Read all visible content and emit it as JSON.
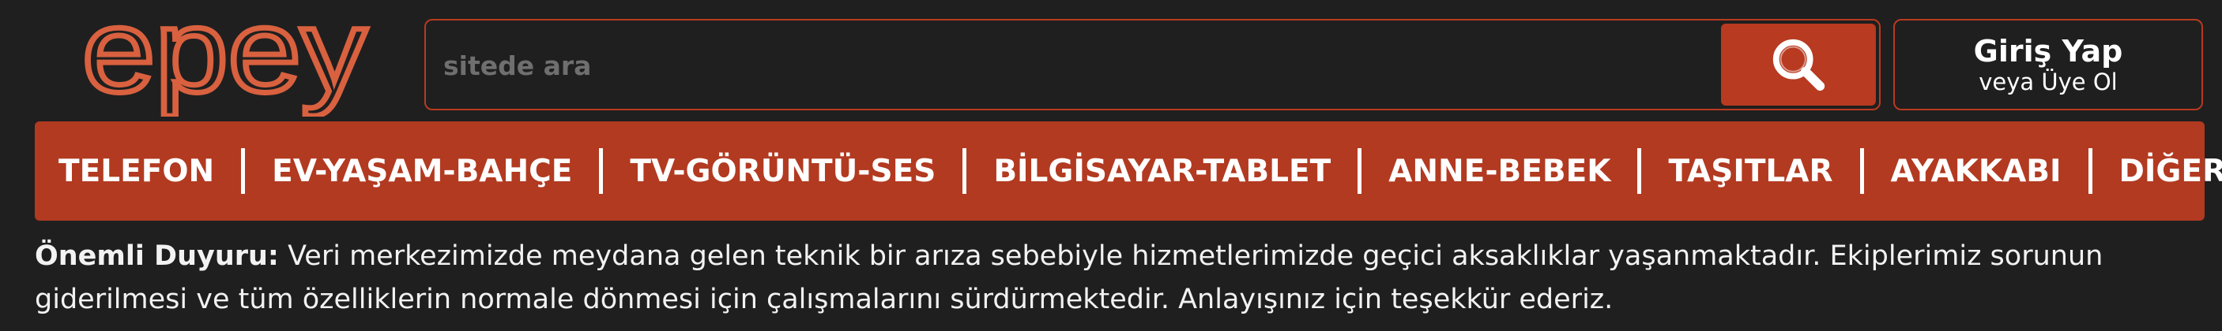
{
  "brand": {
    "logo_text": "epey",
    "logo_color": "#d9613f"
  },
  "colors": {
    "accent": "#b23a21",
    "background": "#1f1f1f",
    "text": "#ffffff"
  },
  "search": {
    "placeholder": "sitede ara",
    "value": "",
    "button_icon": "search-icon"
  },
  "account": {
    "login_label": "Giriş Yap",
    "register_label": "veya Üye Ol"
  },
  "nav": {
    "items": [
      {
        "label": "TELEFON"
      },
      {
        "label": "EV-YAŞAM-BAHÇE"
      },
      {
        "label": "TV-GÖRÜNTÜ-SES"
      },
      {
        "label": "BİLGİSAYAR-TABLET"
      },
      {
        "label": "ANNE-BEBEK"
      },
      {
        "label": "TAŞITLAR"
      },
      {
        "label": "AYAKKABI"
      },
      {
        "label": "DİĞER"
      }
    ]
  },
  "notice": {
    "title": "Önemli Duyuru:",
    "text": "Veri merkezimizde meydana gelen teknik bir arıza sebebiyle hizmetlerimizde geçici aksaklıklar yaşanmaktadır. Ekiplerimiz sorunun giderilmesi ve tüm özelliklerin normale dönmesi için çalışmalarını sürdürmektedir. Anlayışınız için teşekkür ederiz."
  }
}
